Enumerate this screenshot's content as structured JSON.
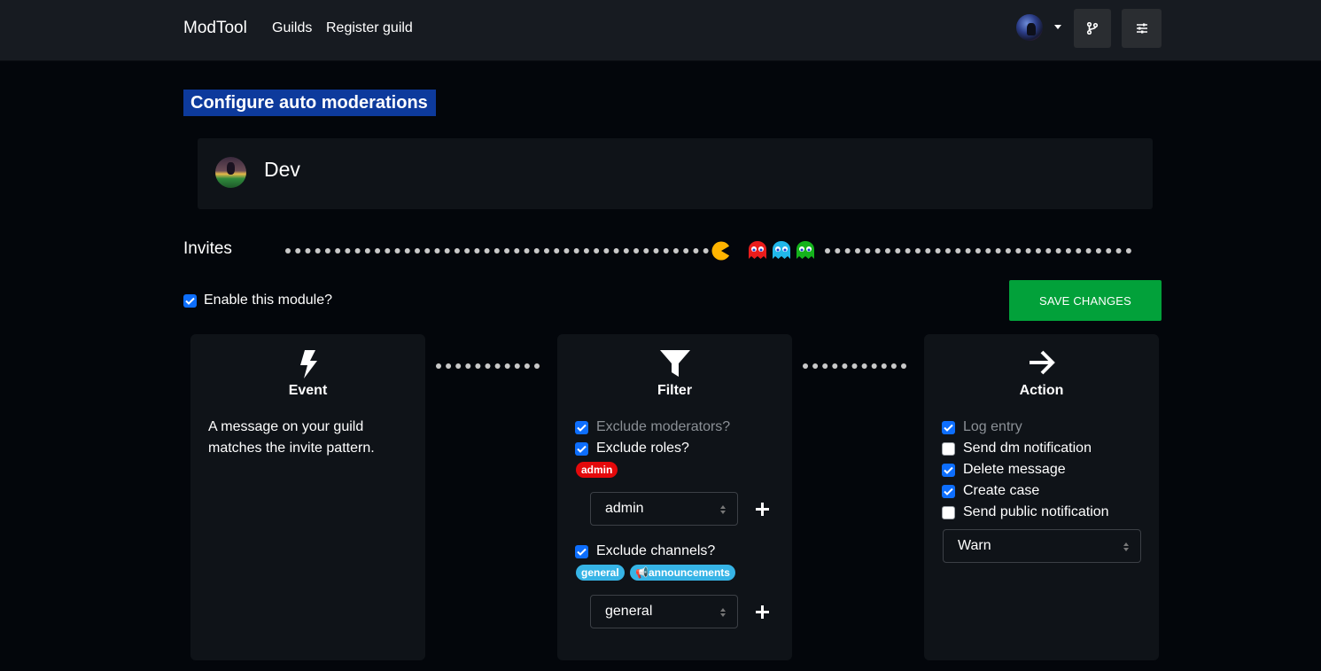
{
  "navbar": {
    "brand": "ModTool",
    "links": [
      "Guilds",
      "Register guild"
    ],
    "avatar_icon": "user-avatar",
    "branch_icon": "git-branch-icon",
    "settings_icon": "sliders-icon"
  },
  "page": {
    "heading": "Configure auto moderations"
  },
  "guild": {
    "name": "Dev"
  },
  "module": {
    "title": "Invites",
    "enable_label": "Enable this module?",
    "enabled": true,
    "save_label": "SAVE CHANGES"
  },
  "event": {
    "title": "Event",
    "icon": "lightning-icon",
    "description": "A message on your guild matches the invite pattern."
  },
  "filter": {
    "title": "Filter",
    "icon": "funnel-icon",
    "exclude_moderators": {
      "label": "Exclude moderators?",
      "checked": true
    },
    "exclude_roles": {
      "label": "Exclude roles?",
      "checked": true
    },
    "role_badges": [
      "admin"
    ],
    "role_select": "admin",
    "exclude_channels": {
      "label": "Exclude channels?",
      "checked": true
    },
    "channel_badges": [
      "general",
      "📢announcements"
    ],
    "channel_select": "general"
  },
  "action": {
    "title": "Action",
    "icon": "arrow-right-icon",
    "options": [
      {
        "label": "Log entry",
        "checked": true
      },
      {
        "label": "Send dm notification",
        "checked": false
      },
      {
        "label": "Delete message",
        "checked": true
      },
      {
        "label": "Create case",
        "checked": true
      },
      {
        "label": "Send public notification",
        "checked": false
      }
    ],
    "case_select": "Warn"
  },
  "colors": {
    "accent": "#0d6efd",
    "save": "#02a13a",
    "heading_bg": "#0d3a9c",
    "badge_red": "#e4090b",
    "badge_blue": "#36b4e6"
  }
}
